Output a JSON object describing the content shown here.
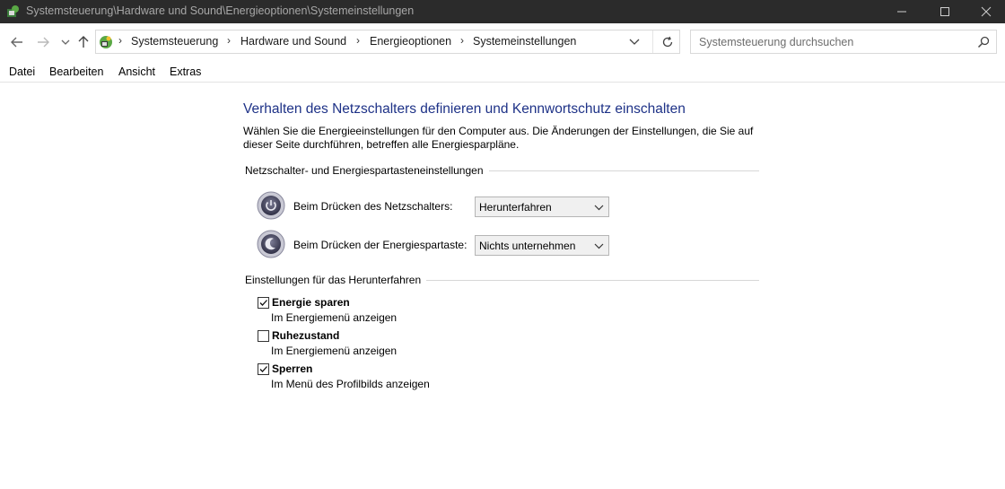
{
  "window": {
    "title": "Systemsteuerung\\Hardware und Sound\\Energieoptionen\\Systemeinstellungen"
  },
  "breadcrumb": {
    "separator": "›",
    "items": [
      "Systemsteuerung",
      "Hardware und Sound",
      "Energieoptionen",
      "Systemeinstellungen"
    ]
  },
  "search": {
    "placeholder": "Systemsteuerung durchsuchen"
  },
  "menu": {
    "items": [
      "Datei",
      "Bearbeiten",
      "Ansicht",
      "Extras"
    ]
  },
  "page": {
    "heading": "Verhalten des Netzschalters definieren und Kennwortschutz einschalten",
    "description": "Wählen Sie die Energieeinstellungen für den Computer aus. Die Änderungen der Einstellungen, die Sie auf dieser Seite durchführen, betreffen alle Energiesparpläne."
  },
  "buttons_section": {
    "title": "Netzschalter- und Energiespartasteneinstellungen",
    "rows": [
      {
        "label": "Beim Drücken des Netzschalters:",
        "value": "Herunterfahren",
        "icon": "power-button-icon"
      },
      {
        "label": "Beim Drücken der Energiespartaste:",
        "value": "Nichts unternehmen",
        "icon": "sleep-button-icon"
      }
    ]
  },
  "shutdown_section": {
    "title": "Einstellungen für das Herunterfahren",
    "options": [
      {
        "title": "Energie sparen",
        "subtitle": "Im Energiemenü anzeigen",
        "checked": true
      },
      {
        "title": "Ruhezustand",
        "subtitle": "Im Energiemenü anzeigen",
        "checked": false
      },
      {
        "title": "Sperren",
        "subtitle": "Im Menü des Profilbilds anzeigen",
        "checked": true
      }
    ]
  },
  "colors": {
    "titlebar_bg": "#2b2b2b",
    "heading": "#1e3287"
  }
}
